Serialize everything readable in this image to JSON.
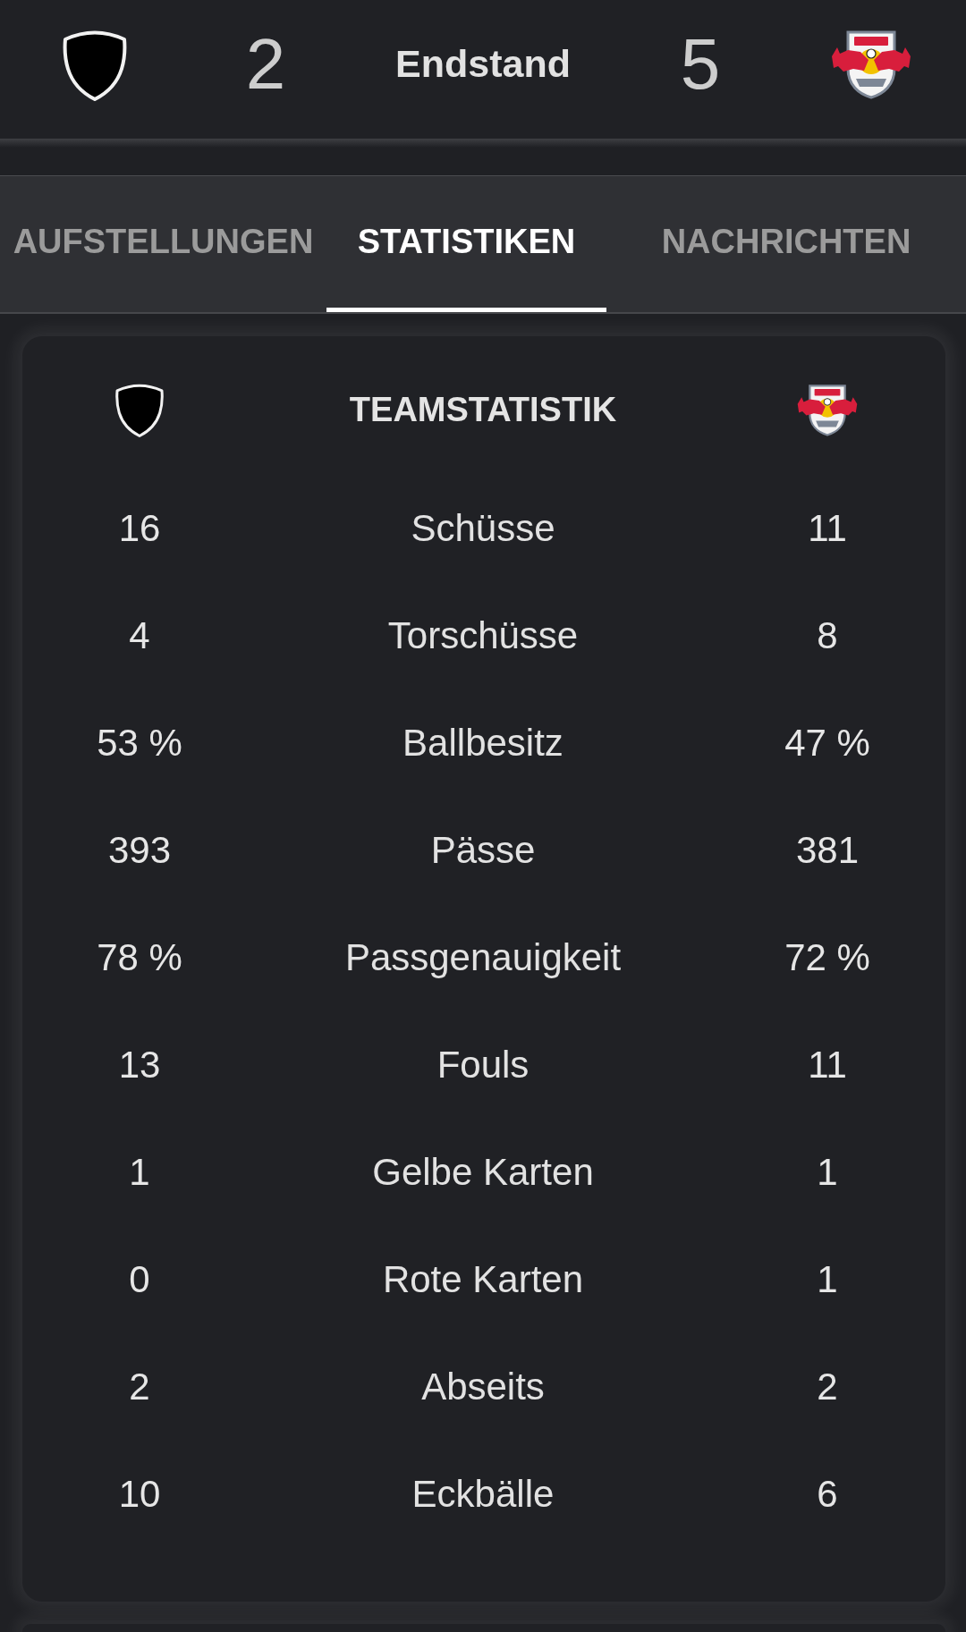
{
  "header": {
    "home_score": "2",
    "status": "Endstand",
    "away_score": "5"
  },
  "tabs": [
    {
      "label": "AUFSTELLUNGEN",
      "selected": false
    },
    {
      "label": "STATISTIKEN",
      "selected": true
    },
    {
      "label": "NACHRICHTEN",
      "selected": false
    }
  ],
  "team_stats": {
    "title": "TEAMSTATISTIK",
    "rows": [
      {
        "label": "Schüsse",
        "home": "16",
        "away": "11"
      },
      {
        "label": "Torschüsse",
        "home": "4",
        "away": "8"
      },
      {
        "label": "Ballbesitz",
        "home": "53 %",
        "away": "47 %"
      },
      {
        "label": "Pässe",
        "home": "393",
        "away": "381"
      },
      {
        "label": "Passgenauigkeit",
        "home": "78 %",
        "away": "72 %"
      },
      {
        "label": "Fouls",
        "home": "13",
        "away": "11"
      },
      {
        "label": "Gelbe Karten",
        "home": "1",
        "away": "1"
      },
      {
        "label": "Rote Karten",
        "home": "0",
        "away": "1"
      },
      {
        "label": "Abseits",
        "home": "2",
        "away": "2"
      },
      {
        "label": "Eckbälle",
        "home": "10",
        "away": "6"
      }
    ]
  }
}
